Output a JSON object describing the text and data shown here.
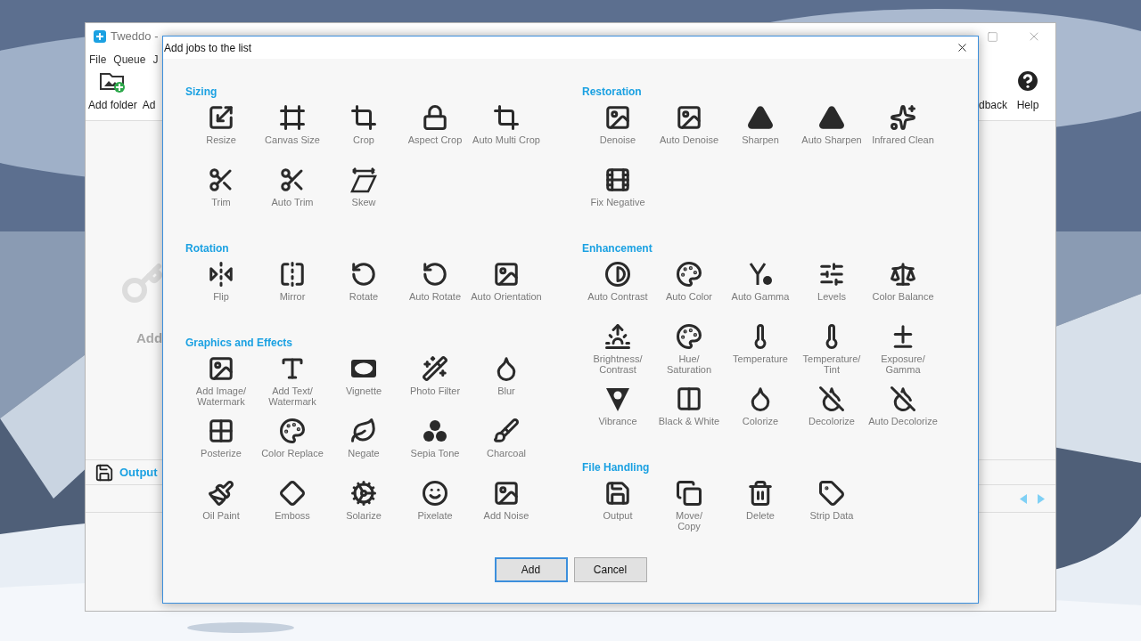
{
  "app_window": {
    "title": "Tweddo -",
    "menu": [
      "File",
      "Queue",
      "J"
    ],
    "toolbar_left": [
      "Add folder",
      "Ad"
    ],
    "toolbar_right": [
      "dback",
      "Help"
    ],
    "empty_hint": "Add",
    "output_label": "Output"
  },
  "dialog": {
    "title": "Add jobs to the list",
    "columns": [
      [
        {
          "heading": "Sizing",
          "items": [
            {
              "label": "Resize"
            },
            {
              "label": "Canvas Size"
            },
            {
              "label": "Crop"
            },
            {
              "label": "Aspect Crop"
            },
            {
              "label": "Auto Multi Crop"
            },
            {
              "label": "Trim"
            },
            {
              "label": "Auto Trim"
            },
            {
              "label": "Skew"
            }
          ]
        },
        {
          "heading": "Rotation",
          "items": [
            {
              "label": "Flip"
            },
            {
              "label": "Mirror"
            },
            {
              "label": "Rotate"
            },
            {
              "label": "Auto Rotate"
            },
            {
              "label": "Auto Orientation"
            }
          ]
        },
        {
          "heading": "Graphics and Effects",
          "items": [
            {
              "label": "Add Image/\nWatermark"
            },
            {
              "label": "Add Text/\nWatermark"
            },
            {
              "label": "Vignette"
            },
            {
              "label": "Photo Filter"
            },
            {
              "label": "Blur"
            },
            {
              "label": "Posterize"
            },
            {
              "label": "Color Replace"
            },
            {
              "label": "Negate"
            },
            {
              "label": "Sepia Tone"
            },
            {
              "label": "Charcoal"
            },
            {
              "label": "Oil Paint"
            },
            {
              "label": "Emboss"
            },
            {
              "label": "Solarize"
            },
            {
              "label": "Pixelate"
            },
            {
              "label": "Add Noise"
            }
          ]
        }
      ],
      [
        {
          "heading": "Restoration",
          "items": [
            {
              "label": "Denoise"
            },
            {
              "label": "Auto Denoise"
            },
            {
              "label": "Sharpen"
            },
            {
              "label": "Auto Sharpen"
            },
            {
              "label": "Infrared Clean"
            },
            {
              "label": "Fix Negative"
            }
          ]
        },
        {
          "heading": "Enhancement",
          "items": [
            {
              "label": "Auto Contrast"
            },
            {
              "label": "Auto Color"
            },
            {
              "label": "Auto Gamma"
            },
            {
              "label": "Levels"
            },
            {
              "label": "Color Balance"
            },
            {
              "label": "Brightness/\nContrast"
            },
            {
              "label": "Hue/\nSaturation"
            },
            {
              "label": "Temperature"
            },
            {
              "label": "Temperature/\nTint"
            },
            {
              "label": "Exposure/\nGamma"
            },
            {
              "label": "Vibrance"
            },
            {
              "label": "Black & White"
            },
            {
              "label": "Colorize"
            },
            {
              "label": "Decolorize"
            },
            {
              "label": "Auto Decolorize"
            }
          ]
        },
        {
          "heading": "File Handling",
          "items": [
            {
              "label": "Output"
            },
            {
              "label": "Move/\nCopy"
            },
            {
              "label": "Delete"
            },
            {
              "label": "Strip Data"
            }
          ]
        }
      ]
    ],
    "buttons": [
      {
        "label": "Add",
        "default": true
      },
      {
        "label": "Cancel",
        "default": false
      }
    ]
  }
}
